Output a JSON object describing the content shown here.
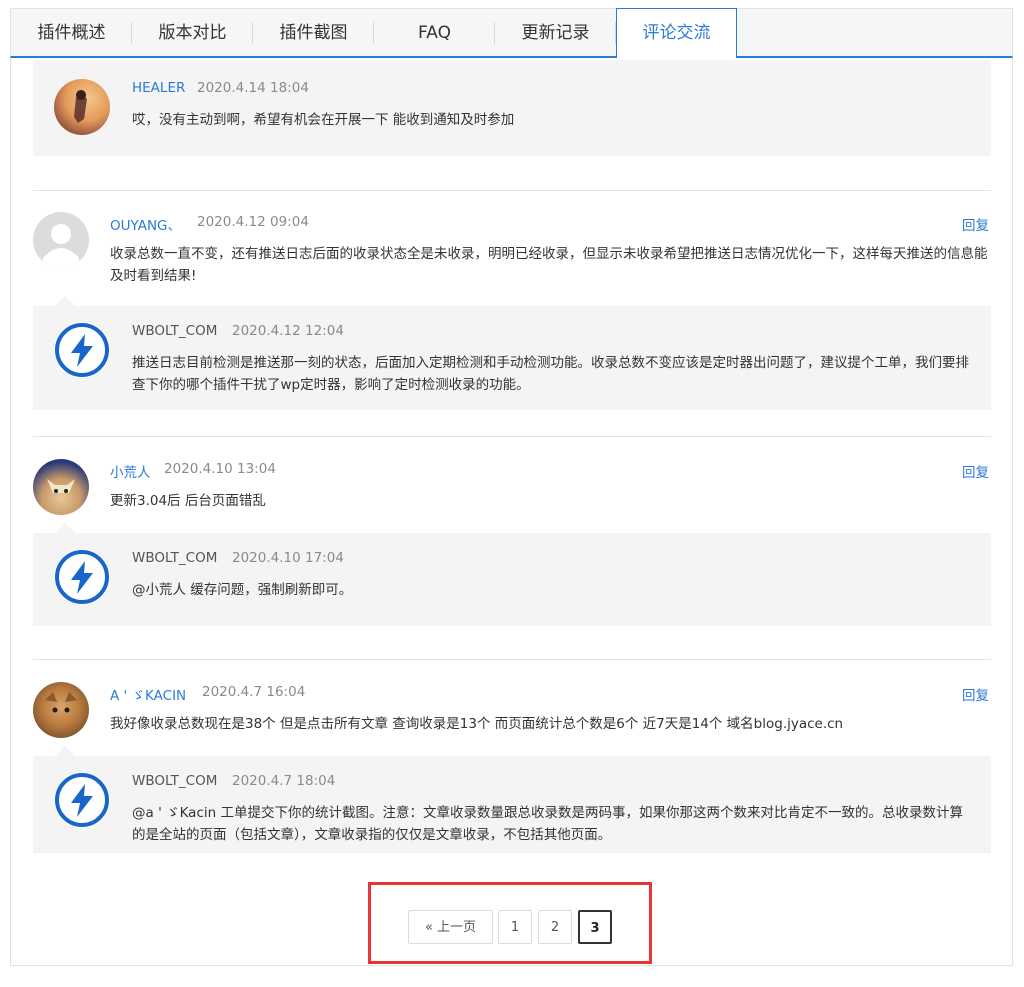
{
  "tabs": [
    "插件概述",
    "版本对比",
    "插件截图",
    "FAQ",
    "更新记录",
    "评论交流"
  ],
  "reply_label": "回复",
  "comments": [
    {
      "name": "HEALER",
      "date": "2020.4.14 18:04",
      "text": "哎，没有主动到啊，希望有机会在开展一下 能收到通知及时参加"
    },
    {
      "name": "OUYANG、",
      "date": "2020.4.12 09:04",
      "text": "收录总数一直不变，还有推送日志后面的收录状态全是未收录，明明已经收录，但显示未收录希望把推送日志情况优化一下，这样每天推送的信息能及时看到结果!",
      "reply": {
        "name": "WBOLT_COM",
        "date": "2020.4.12 12:04",
        "text": "推送日志目前检测是推送那一刻的状态，后面加入定期检测和手动检测功能。收录总数不变应该是定时器出问题了，建议提个工单，我们要排查下你的哪个插件干扰了wp定时器，影响了定时检测收录的功能。"
      }
    },
    {
      "name": "小荒人",
      "date": "2020.4.10 13:04",
      "text": "更新3.04后 后台页面错乱",
      "reply": {
        "name": "WBOLT_COM",
        "date": "2020.4.10 17:04",
        "text": "@小荒人 缓存问题，强制刷新即可。"
      }
    },
    {
      "name": "A ' ゞKACIN",
      "date": "2020.4.7 16:04",
      "text": "我好像收录总数现在是38个 但是点击所有文章 查询收录是13个 而页面统计总个数是6个 近7天是14个 域名blog.jyace.cn",
      "reply": {
        "name": "WBOLT_COM",
        "date": "2020.4.7 18:04",
        "text": "@a ' ゞKacin 工单提交下你的统计截图。注意：文章收录数量跟总收录数是两码事，如果你那这两个数来对比肯定不一致的。总收录数计算的是全站的页面（包括文章），文章收录指的仅仅是文章收录，不包括其他页面。"
      }
    }
  ],
  "pagination": {
    "prev": "« 上一页",
    "pages": [
      "1",
      "2",
      "3"
    ],
    "current": "3"
  },
  "colors": {
    "accent": "#2b7bd6",
    "highlight": "#e53535",
    "reply_bg": "#f4f4f4"
  }
}
